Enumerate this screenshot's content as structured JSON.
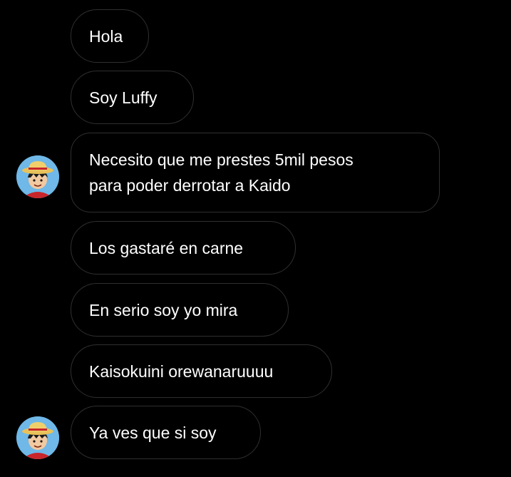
{
  "conversation": {
    "messages": [
      {
        "lines": [
          "Hola"
        ]
      },
      {
        "lines": [
          "Soy Luffy"
        ]
      },
      {
        "lines": [
          "Necesito que me prestes 5mil pesos",
          "para poder derrotar a Kaido"
        ]
      },
      {
        "lines": [
          "Los gastaré en carne"
        ]
      },
      {
        "lines": [
          "En serio soy yo mira"
        ]
      },
      {
        "lines": [
          "Kaisokuini orewanaruuuu"
        ]
      },
      {
        "lines": [
          "Ya ves que si soy"
        ]
      }
    ],
    "sender_avatar": {
      "icon": "luffy-straw-hat-avatar"
    }
  },
  "colors": {
    "background": "#000000",
    "bubble_border": "#2f2f2f",
    "text": "#ffffff",
    "avatar_bg": "#6fb8e8"
  }
}
